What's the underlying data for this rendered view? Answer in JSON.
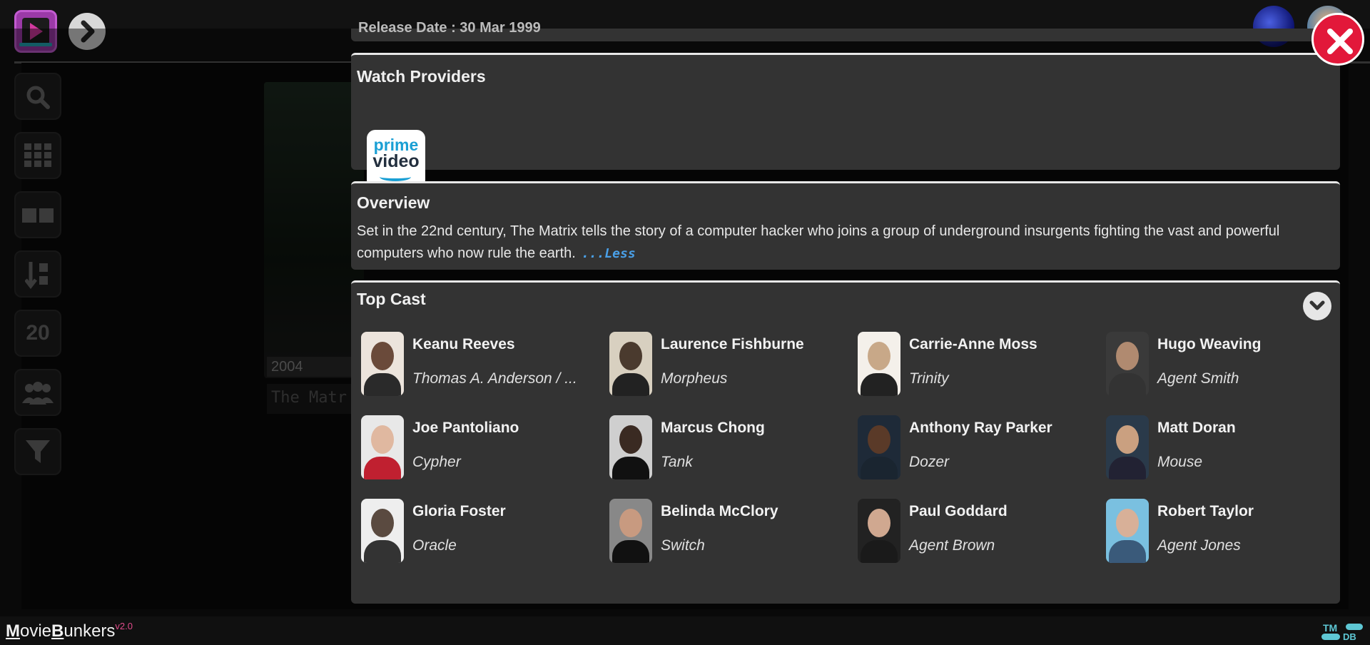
{
  "app": {
    "brand_m": "M",
    "brand_ovie": "ovie",
    "brand_b": "B",
    "brand_unkers": "unkers",
    "version": "v2.0",
    "tmdb_top": "TM",
    "tmdb_bottom": "DB"
  },
  "background": {
    "poster_year": "2004",
    "poster_title": "The Matr",
    "sidebar_number": "20"
  },
  "modal": {
    "partial_heading": "Release Date : 30 Mar 1999",
    "watch_providers": {
      "title": "Watch Providers",
      "provider_line1": "prime",
      "provider_line2": "video"
    },
    "overview": {
      "title": "Overview",
      "text": "Set in the 22nd century, The Matrix tells the story of a computer hacker who joins a group of underground insurgents fighting the vast and powerful computers who now rule the earth.",
      "less_label": "...Less"
    },
    "top_cast": {
      "title": "Top Cast",
      "members": [
        {
          "name": "Keanu Reeves",
          "role": "Thomas A. Anderson / ..."
        },
        {
          "name": "Laurence Fishburne",
          "role": "Morpheus"
        },
        {
          "name": "Carrie-Anne Moss",
          "role": "Trinity"
        },
        {
          "name": "Hugo Weaving",
          "role": "Agent Smith"
        },
        {
          "name": "Joe Pantoliano",
          "role": "Cypher"
        },
        {
          "name": "Marcus Chong",
          "role": "Tank"
        },
        {
          "name": "Anthony Ray Parker",
          "role": "Dozer"
        },
        {
          "name": "Matt Doran",
          "role": "Mouse"
        },
        {
          "name": "Gloria Foster",
          "role": "Oracle"
        },
        {
          "name": "Belinda McClory",
          "role": "Switch"
        },
        {
          "name": "Paul Goddard",
          "role": "Agent Brown"
        },
        {
          "name": "Robert Taylor",
          "role": "Agent Jones"
        }
      ]
    }
  },
  "colors": {
    "panel": "#333333",
    "close_button": "#e2183a",
    "link": "#4aa0e8",
    "accent": "#5ec7d4"
  }
}
